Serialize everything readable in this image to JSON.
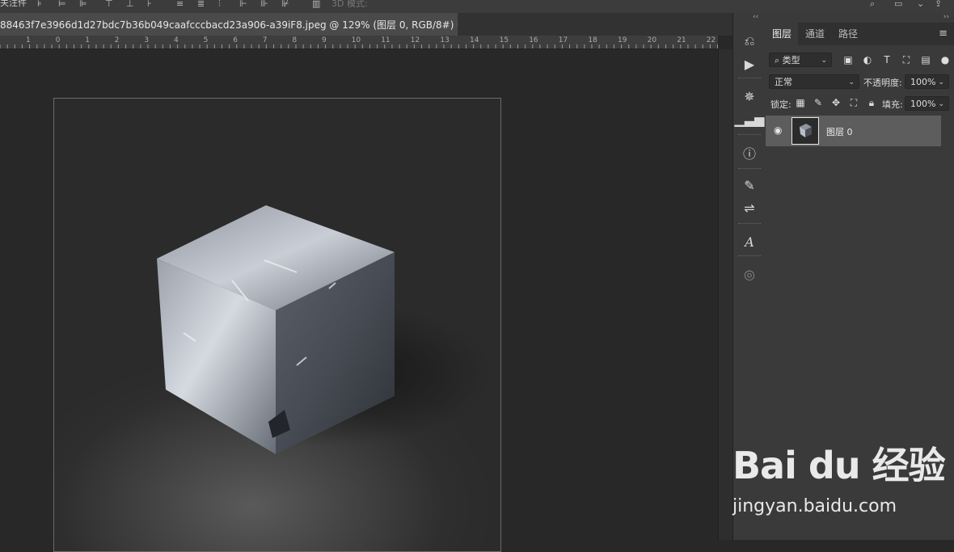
{
  "options_bar": {
    "label": "关注件",
    "hint_3d": "3D 模式:",
    "icons": [
      "align-left-icon",
      "align-hcenter-icon",
      "align-right-icon",
      "distribute-icon",
      "search-icon",
      "workspace-icon",
      "share-icon"
    ]
  },
  "document_tab": {
    "title": "88463f7e3966d1d27bdc7b36b049caafcccbacd23a906-a39iF8.jpeg @ 129% (图层 0, RGB/8#) *"
  },
  "ruler": {
    "labels": [
      "1",
      "0",
      "1",
      "2",
      "3",
      "4",
      "5",
      "6",
      "7",
      "8",
      "9",
      "10",
      "11",
      "12",
      "13",
      "14",
      "15",
      "16",
      "17",
      "18",
      "19",
      "20",
      "21",
      "22"
    ]
  },
  "layers_panel": {
    "tabs": [
      "图层",
      "通道",
      "路径"
    ],
    "active_tab": "图层",
    "filter_kind": "类型",
    "blend_mode": "正常",
    "opacity_label": "不透明度:",
    "opacity_value": "100%",
    "lock_label": "锁定:",
    "fill_label": "填充:",
    "fill_value": "100%",
    "layers": [
      {
        "name": "图层 0",
        "visible": true
      }
    ]
  },
  "tools": [
    "history-icon",
    "play-action-icon",
    "navigator-icon",
    "histogram-icon",
    "info-icon",
    "brush-settings-icon",
    "adjust-icon",
    "character-icon",
    "properties-icon"
  ],
  "watermark": {
    "line1": "Bai du 经验",
    "line2": "jingyan.baidu.com"
  },
  "colors": {
    "bg": "#282828",
    "panel": "#3a3a3a",
    "layer_selected": "#5d5d5d"
  }
}
